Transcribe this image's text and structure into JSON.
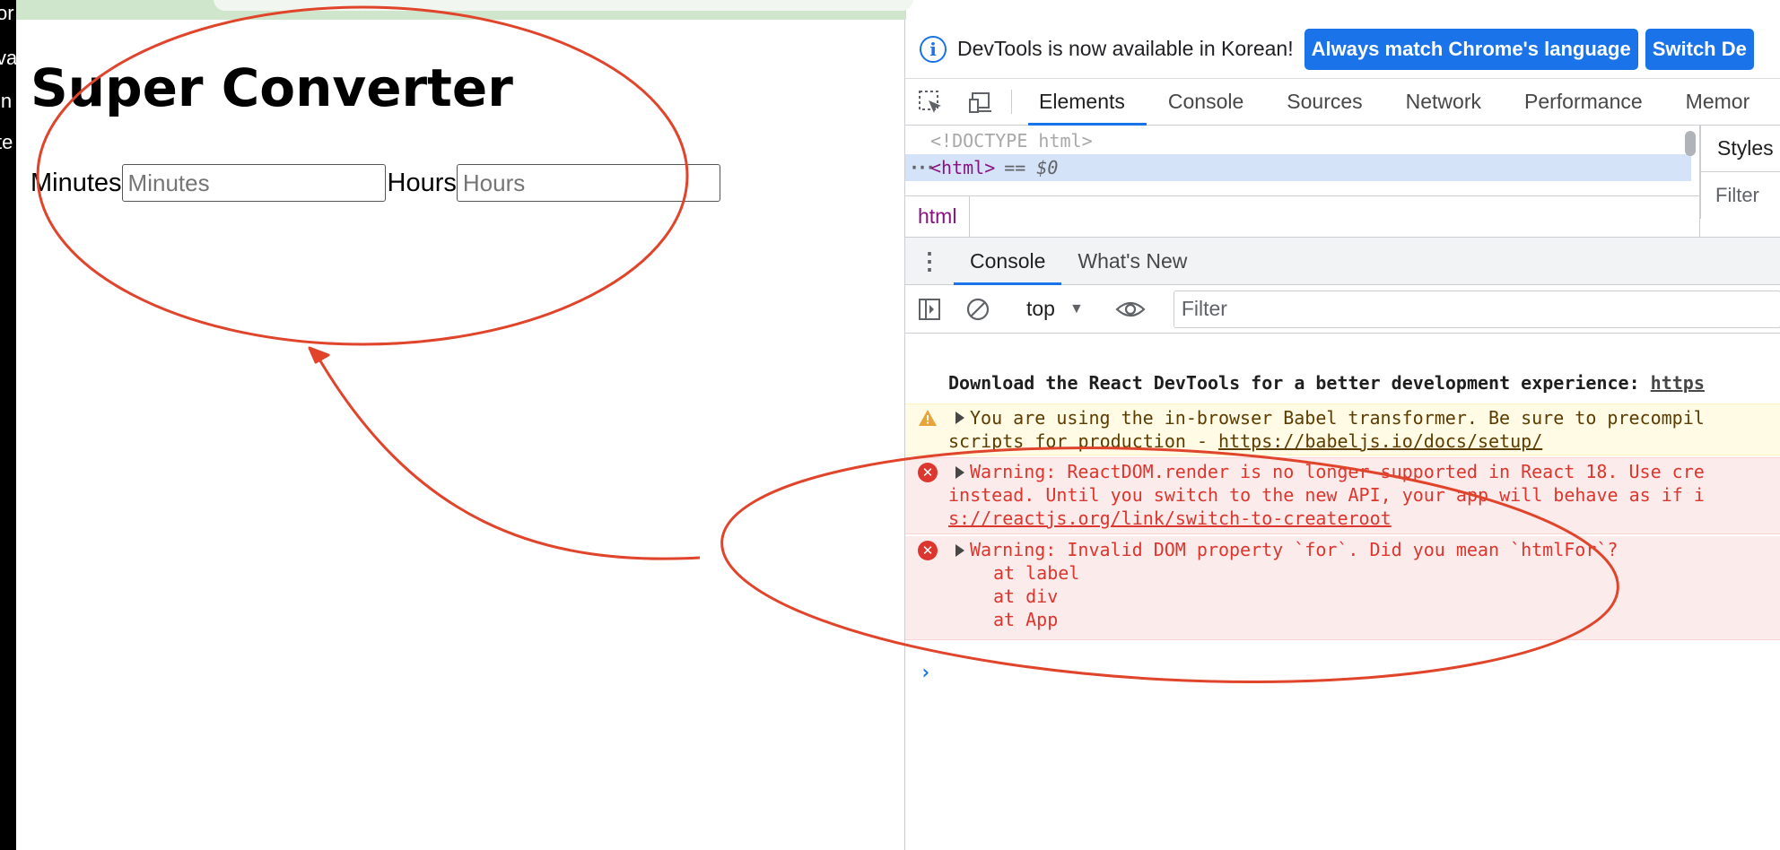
{
  "left_strip": {
    "fragments": [
      "or",
      "va",
      "in",
      "te"
    ]
  },
  "page": {
    "title": "Super Converter",
    "minutes_label": "Minutes",
    "minutes_placeholder": "Minutes",
    "hours_label": "Hours",
    "hours_placeholder": "Hours"
  },
  "devtools": {
    "infobar": {
      "icon": "info-icon",
      "text": "DevTools is now available in Korean!",
      "button_match": "Always match Chrome's language",
      "button_switch": "Switch De"
    },
    "tabs": [
      "Elements",
      "Console",
      "Sources",
      "Network",
      "Performance",
      "Memor"
    ],
    "active_tab": "Elements",
    "elements": {
      "doctype": "<!DOCTYPE html>",
      "html_tag": "<html>",
      "selected_marker": "== $0",
      "breadcrumb": "html"
    },
    "styles": {
      "tab": "Styles",
      "filter": "Filter"
    },
    "drawer_tabs": [
      "Console",
      "What's New"
    ],
    "console_toolbar": {
      "context": "top",
      "filter_placeholder": "Filter"
    },
    "messages": {
      "log": {
        "text": "Download the React DevTools for a better development experience: ",
        "link": "https"
      },
      "warning": {
        "line1": "You are using the in-browser Babel transformer. Be sure to precompil",
        "line2_prefix": "scripts for production - ",
        "line2_link": "https://babeljs.io/docs/setup/"
      },
      "error1": {
        "line1": "Warning: ReactDOM.render is no longer supported in React 18. Use cre",
        "line2": "instead. Until you switch to the new API, your app will behave as if i",
        "line3": "s://reactjs.org/link/switch-to-createroot"
      },
      "error2": {
        "line1": "Warning: Invalid DOM property `for`. Did you mean `htmlFor`?",
        "line2": "at label",
        "line3": "at div",
        "line4": "at App"
      },
      "prompt": "›"
    }
  },
  "colors": {
    "annotation": "#e0442b",
    "accent": "#1a73e8",
    "error": "#dc362e",
    "warning_bg": "#fffbe5"
  }
}
